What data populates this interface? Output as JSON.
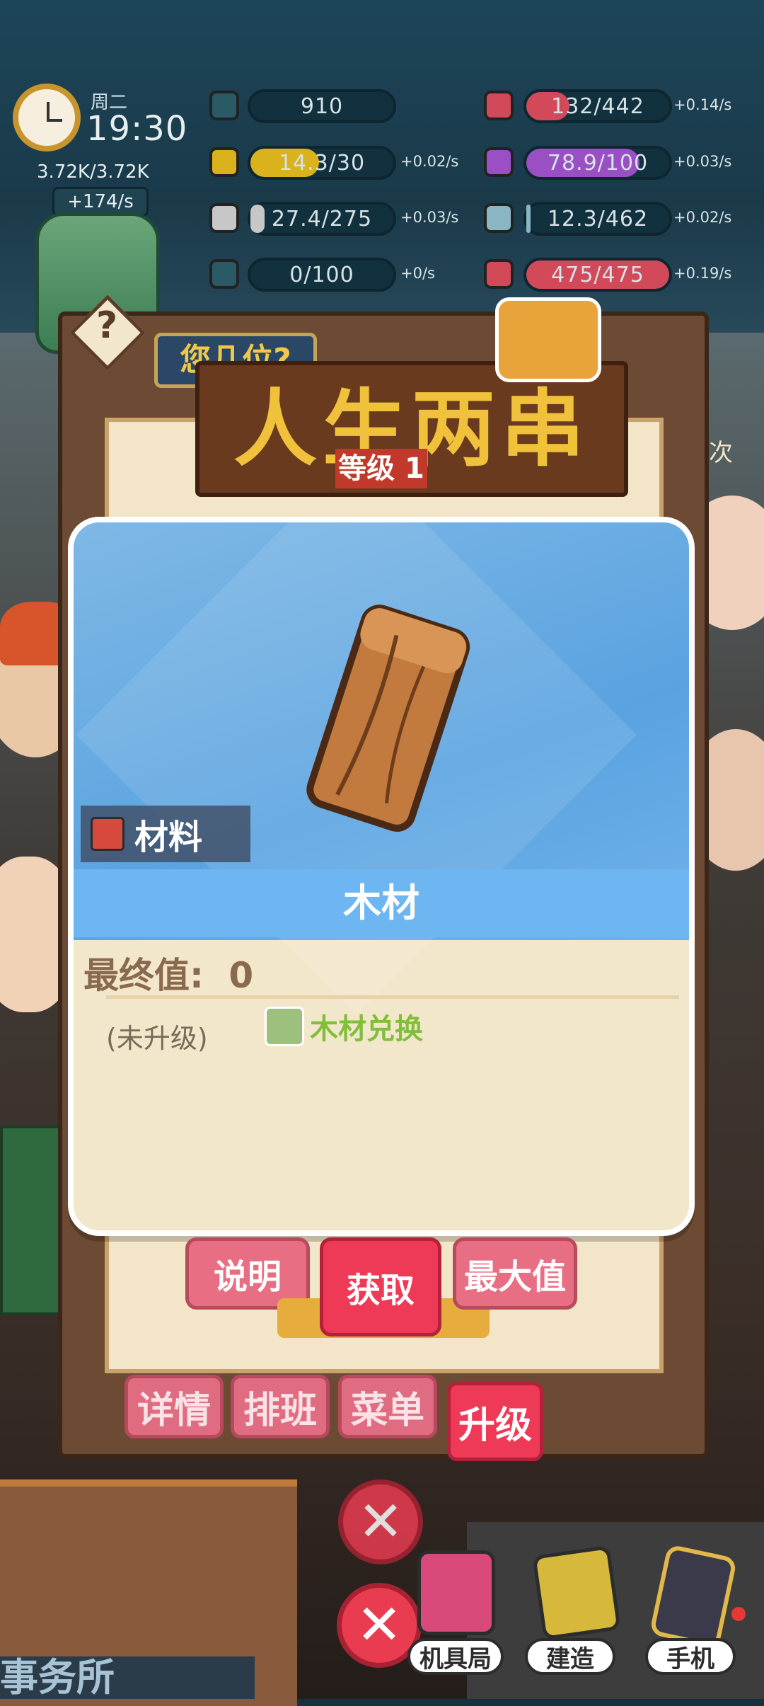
{
  "status": {
    "weekday": "周二",
    "time": "19:30",
    "cash": "3.72K/3.72K",
    "cash_rate": "+174/s",
    "resources_left": [
      {
        "icon": "peach-icon",
        "value": "910",
        "rate": "",
        "fill": 0.0,
        "color": "#2a5a66"
      },
      {
        "icon": "gold-bar-icon",
        "value": "14.3/30",
        "rate": "+0.02/s",
        "fill": 0.48,
        "color": "#d9b21c"
      },
      {
        "icon": "coal-icon",
        "value": "27.4/275",
        "rate": "+0.03/s",
        "fill": 0.1,
        "color": "#c7c7c7"
      },
      {
        "icon": "wood-plank-icon",
        "value": "0/100",
        "rate": "+0/s",
        "fill": 0.0,
        "color": "#2a5a66"
      }
    ],
    "resources_right": [
      {
        "icon": "ticket-icon",
        "value": "132/442",
        "rate": "+0.14/s",
        "fill": 0.3,
        "color": "#d24a5a"
      },
      {
        "icon": "chocolate-icon",
        "value": "78.9/100",
        "rate": "+0.03/s",
        "fill": 0.79,
        "color": "#9b4fc4"
      },
      {
        "icon": "water-bottle-icon",
        "value": "12.3/462",
        "rate": "+0.02/s",
        "fill": 0.03,
        "color": "#8ab6c4"
      },
      {
        "icon": "heart-icon",
        "value": "475/475",
        "rate": "+0.19/s",
        "fill": 1.0,
        "color": "#d24a5a"
      }
    ]
  },
  "restaurant": {
    "sign_small": "您几位?",
    "sign_big": "人生两串",
    "level": "等级 1",
    "side_text": "次"
  },
  "modal": {
    "category": "材料",
    "item_name": "木材",
    "final_value_label": "最终值:",
    "final_value": "0",
    "status_text": "(未升级)",
    "exchange_link": "木材兑换"
  },
  "actions": {
    "explain": "说明",
    "obtain": "获取",
    "max": "最大值"
  },
  "tabs": [
    "详情",
    "排班",
    "菜单",
    "升级"
  ],
  "nav": {
    "shop": "机具局",
    "build": "建造",
    "phone": "手机"
  },
  "street_sign": "事务所"
}
